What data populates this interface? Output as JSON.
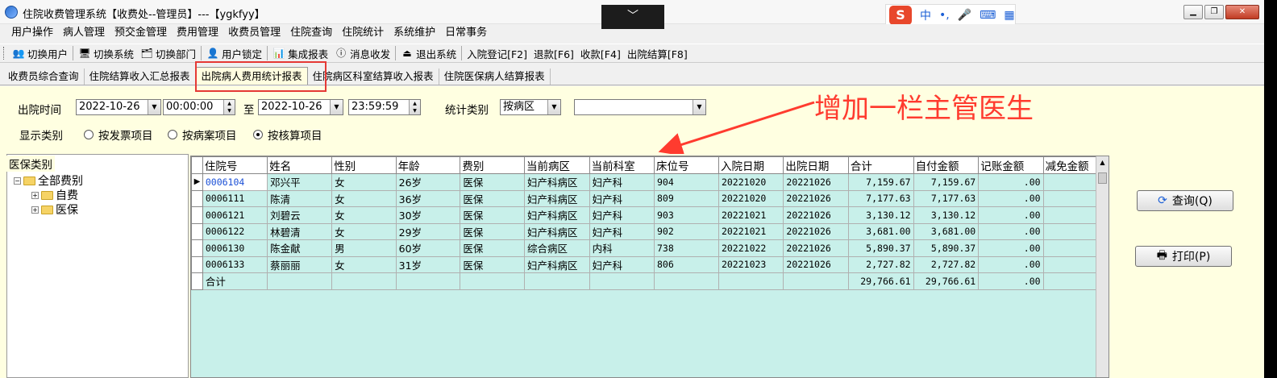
{
  "window": {
    "title": "住院收费管理系统【收费处--管理员】---【ygkfyy】",
    "collapse_glyph": "﹀",
    "controls": {
      "minimize": "▁",
      "restore": "❐",
      "close": "✕"
    }
  },
  "ime": {
    "logo": "S",
    "items": [
      "中",
      "•,",
      "🎤",
      "⌨",
      "▦"
    ]
  },
  "menu": [
    "用户操作",
    "病人管理",
    "预交金管理",
    "费用管理",
    "收费员管理",
    "住院查询",
    "住院统计",
    "系统维护",
    "日常事务"
  ],
  "toolbar": [
    {
      "icon": "switch-user-icon",
      "glyph": "👥",
      "label": "切换用户"
    },
    {
      "icon": "switch-system-icon",
      "glyph": "🖥",
      "label": "切换系统"
    },
    {
      "icon": "switch-dept-icon",
      "glyph": "🗂",
      "label": "切换部门"
    },
    {
      "icon": "user-lock-icon",
      "glyph": "👤",
      "label": "用户锁定"
    },
    {
      "icon": "report-icon",
      "glyph": "📊",
      "label": "集成报表"
    },
    {
      "icon": "message-icon",
      "glyph": "ⓘ",
      "label": "消息收发"
    },
    {
      "icon": "exit-icon",
      "glyph": "⏏",
      "label": "退出系统"
    },
    {
      "icon": "",
      "glyph": "",
      "label": "入院登记[F2]"
    },
    {
      "icon": "",
      "glyph": "",
      "label": "退款[F6]"
    },
    {
      "icon": "",
      "glyph": "",
      "label": "收款[F4]"
    },
    {
      "icon": "",
      "glyph": "",
      "label": "出院结算[F8]"
    }
  ],
  "tabs": [
    {
      "label": "收费员综合查询",
      "active": false
    },
    {
      "label": "住院结算收入汇总报表",
      "active": false
    },
    {
      "label": "出院病人费用统计报表",
      "active": true
    },
    {
      "label": "住院病区科室结算收入报表",
      "active": false
    },
    {
      "label": "住院医保病人结算报表",
      "active": false
    }
  ],
  "filter": {
    "discharge_time_label": "出院时间",
    "start_date": "2022-10-26",
    "start_time": "00:00:00",
    "to_label": "至",
    "end_date": "2022-10-26",
    "end_time": "23:59:59",
    "stat_type_label": "统计类别",
    "stat_type_value": "按病区",
    "secondary_value": "",
    "display_type_label": "显示类别",
    "radios": [
      {
        "label": "按发票项目",
        "checked": false
      },
      {
        "label": "按病案项目",
        "checked": false
      },
      {
        "label": "按核算项目",
        "checked": true
      }
    ]
  },
  "annotation": {
    "text": "增加一栏主管医生",
    "color": "#ff3b2f"
  },
  "tree": {
    "caption": "医保类别",
    "root": "全部费别",
    "children": [
      "自费",
      "医保"
    ]
  },
  "grid": {
    "columns": [
      "住院号",
      "姓名",
      "性别",
      "年龄",
      "费别",
      "当前病区",
      "当前科室",
      "床位号",
      "入院日期",
      "出院日期",
      "合计",
      "自付金额",
      "记账金额",
      "减免金额"
    ],
    "rows": [
      [
        "0006104",
        "邓兴平",
        "女",
        "26岁",
        "医保",
        "妇产科病区",
        "妇产科",
        "904",
        "20221020",
        "20221026",
        "7,159.67",
        "7,159.67",
        ".00",
        ""
      ],
      [
        "0006111",
        "陈清",
        "女",
        "36岁",
        "医保",
        "妇产科病区",
        "妇产科",
        "809",
        "20221020",
        "20221026",
        "7,177.63",
        "7,177.63",
        ".00",
        ""
      ],
      [
        "0006121",
        "刘碧云",
        "女",
        "30岁",
        "医保",
        "妇产科病区",
        "妇产科",
        "903",
        "20221021",
        "20221026",
        "3,130.12",
        "3,130.12",
        ".00",
        ""
      ],
      [
        "0006122",
        "林碧清",
        "女",
        "29岁",
        "医保",
        "妇产科病区",
        "妇产科",
        "902",
        "20221021",
        "20221026",
        "3,681.00",
        "3,681.00",
        ".00",
        ""
      ],
      [
        "0006130",
        "陈金献",
        "男",
        "60岁",
        "医保",
        "综合病区",
        "内科",
        "738",
        "20221022",
        "20221026",
        "5,890.37",
        "5,890.37",
        ".00",
        ""
      ],
      [
        "0006133",
        "蔡丽丽",
        "女",
        "31岁",
        "医保",
        "妇产科病区",
        "妇产科",
        "806",
        "20221023",
        "20221026",
        "2,727.82",
        "2,727.82",
        ".00",
        ""
      ],
      [
        "合计",
        "",
        "",
        "",
        "",
        "",
        "",
        "",
        "",
        "",
        "29,766.61",
        "29,766.61",
        ".00",
        ""
      ]
    ]
  },
  "buttons": {
    "query": "查询(Q)",
    "print": "打印(P)"
  },
  "colors": {
    "content_bg": "#ffffe1",
    "grid_bg": "#c8f0ea",
    "highlight": "#e53935"
  }
}
